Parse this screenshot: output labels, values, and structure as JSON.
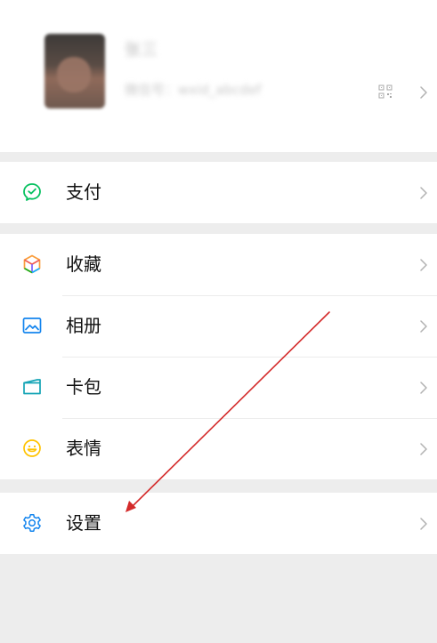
{
  "profile": {
    "name": "张三",
    "wechat_id": "微信号：wxid_abcdef",
    "qr_icon": "qr-code-icon",
    "chevron_icon": "chevron-right-icon"
  },
  "menu_sections": [
    {
      "items": [
        {
          "label": "支付",
          "icon": "pay-icon"
        }
      ]
    },
    {
      "items": [
        {
          "label": "收藏",
          "icon": "favorites-icon"
        },
        {
          "label": "相册",
          "icon": "album-icon"
        },
        {
          "label": "卡包",
          "icon": "card-pack-icon"
        },
        {
          "label": "表情",
          "icon": "emoji-icon"
        }
      ]
    },
    {
      "items": [
        {
          "label": "设置",
          "icon": "settings-icon"
        }
      ]
    }
  ],
  "colors": {
    "background": "#ededed",
    "surface": "#ffffff",
    "text_primary": "#111111",
    "chevron": "#b2b2b2",
    "pay_green": "#07c160",
    "favorites_multicolor": [
      "#fa9d3b",
      "#f25c54",
      "#7b61ff",
      "#1aad19",
      "#10aeff"
    ],
    "album_blue": "#1485ee",
    "card_teal": "#16a5b6",
    "emoji_yellow": "#ffc300",
    "settings_blue": "#1485ee",
    "annotation_arrow": "#d42b2b"
  }
}
